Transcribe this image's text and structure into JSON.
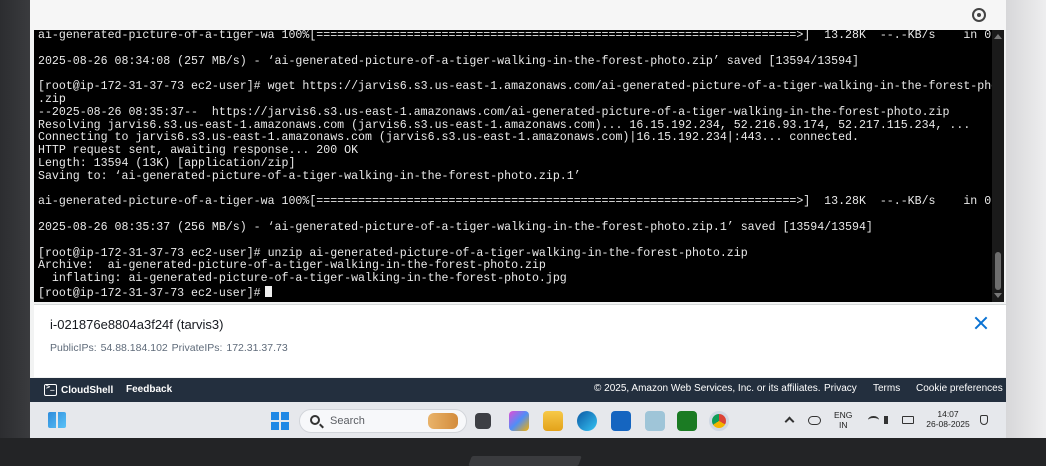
{
  "terminal": {
    "lines": [
      "ai-generated-picture-of-a-tiger-wa 100%[=====================================================================>]  13.28K  --.-KB/s    in 0s",
      "",
      "2025-08-26 08:34:08 (257 MB/s) - ‘ai-generated-picture-of-a-tiger-walking-in-the-forest-photo.zip’ saved [13594/13594]",
      "",
      "[root@ip-172-31-37-73 ec2-user]# wget https://jarvis6.s3.us-east-1.amazonaws.com/ai-generated-picture-of-a-tiger-walking-in-the-forest-photo",
      ".zip",
      "--2025-08-26 08:35:37--  https://jarvis6.s3.us-east-1.amazonaws.com/ai-generated-picture-of-a-tiger-walking-in-the-forest-photo.zip",
      "Resolving jarvis6.s3.us-east-1.amazonaws.com (jarvis6.s3.us-east-1.amazonaws.com)... 16.15.192.234, 52.216.93.174, 52.217.115.234, ...",
      "Connecting to jarvis6.s3.us-east-1.amazonaws.com (jarvis6.s3.us-east-1.amazonaws.com)|16.15.192.234|:443... connected.",
      "HTTP request sent, awaiting response... 200 OK",
      "Length: 13594 (13K) [application/zip]",
      "Saving to: ‘ai-generated-picture-of-a-tiger-walking-in-the-forest-photo.zip.1’",
      "",
      "ai-generated-picture-of-a-tiger-wa 100%[=====================================================================>]  13.28K  --.-KB/s    in 0s",
      "",
      "2025-08-26 08:35:37 (256 MB/s) - ‘ai-generated-picture-of-a-tiger-walking-in-the-forest-photo.zip.1’ saved [13594/13594]",
      "",
      "[root@ip-172-31-37-73 ec2-user]# unzip ai-generated-picture-of-a-tiger-walking-in-the-forest-photo.zip",
      "Archive:  ai-generated-picture-of-a-tiger-walking-in-the-forest-photo.zip",
      "  inflating: ai-generated-picture-of-a-tiger-walking-in-the-forest-photo.jpg",
      "[root@ip-172-31-37-73 ec2-user]#"
    ]
  },
  "instance": {
    "title": "i-021876e8804a3f24f (tarvis3)",
    "ips": "PublicIPs: 54.88.184.102   PrivateIPs: 172.31.37.73"
  },
  "footer": {
    "cloudshell_label": "CloudShell",
    "feedback_label": "Feedback",
    "copyright": "© 2025, Amazon Web Services, Inc. or its affiliates.",
    "privacy_label": "Privacy",
    "terms_label": "Terms",
    "cookie_label": "Cookie preferences"
  },
  "taskbar": {
    "search_placeholder": "Search",
    "language_line1": "ENG",
    "language_line2": "IN",
    "time": "14:07",
    "date": "26-08-2025"
  },
  "colors": {
    "terminal_bg": "#000000",
    "footer_bg": "#232f3e",
    "close_accent": "#0972d3"
  }
}
